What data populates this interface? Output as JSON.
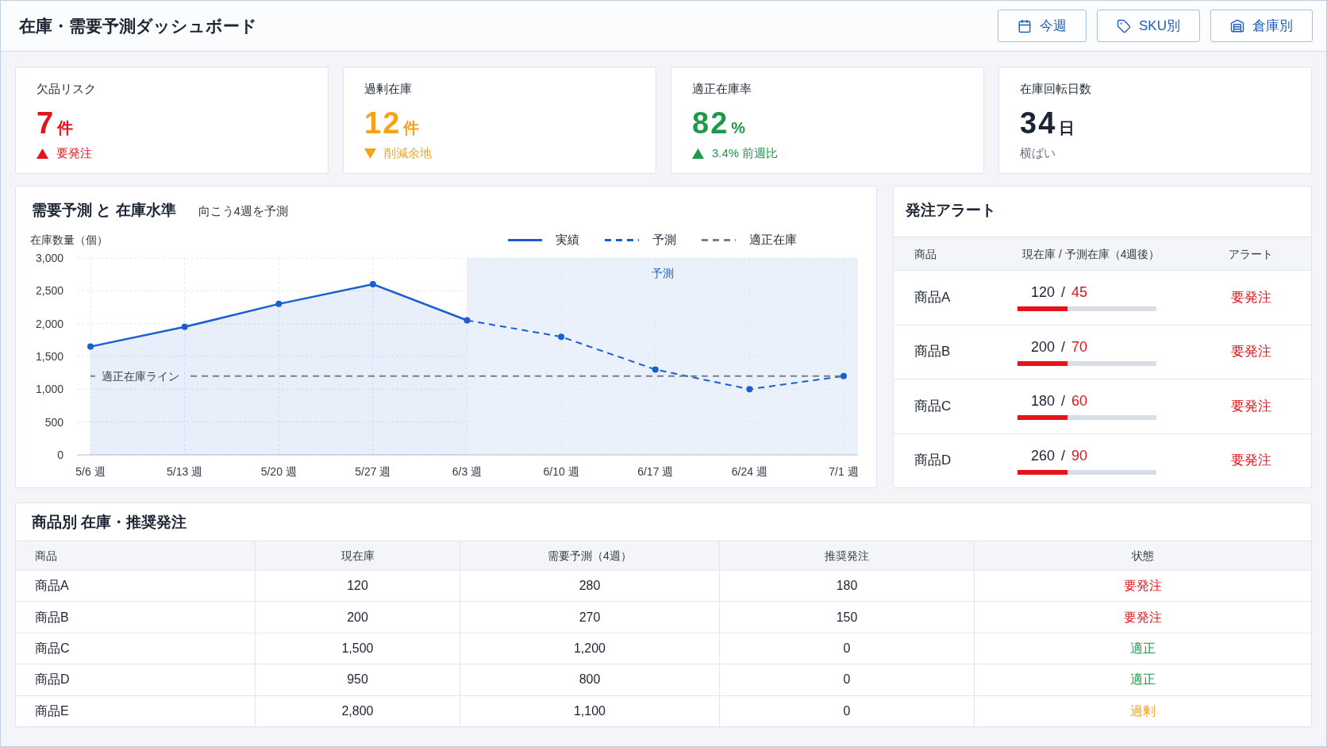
{
  "header": {
    "title": "在庫・需要予測ダッシュボード",
    "buttons": [
      {
        "label": "今週"
      },
      {
        "label": "SKU別"
      },
      {
        "label": "倉庫別"
      }
    ]
  },
  "kpis": [
    {
      "label": "欠品リスク",
      "value": "7",
      "unit": "件",
      "color": "#e3141b",
      "kind": "rise",
      "note": "要発注"
    },
    {
      "label": "過剰在庫",
      "value": "12",
      "unit": "件",
      "color": "#f5a31a",
      "kind": "fall",
      "note": "削減余地"
    },
    {
      "label": "適正在庫率",
      "value": "82",
      "unit": "%",
      "color": "#1e9a4b",
      "kind": "rise",
      "note": "3.4% 前週比"
    },
    {
      "label": "在庫回転日数",
      "value": "34",
      "unit": "日",
      "color": "#1b2433",
      "kind": "flat",
      "note": "横ばい"
    }
  ],
  "demand_chart": {
    "title": "需要予測 と 在庫水準",
    "subtitle": "向こう4週を予測",
    "chart_data": {
      "type": "line",
      "ylabel": "在庫数量（個）",
      "categories": [
        "5/6 週",
        "5/13 週",
        "5/20 週",
        "5/27 週",
        "6/3 週",
        "6/10 週",
        "6/17 週",
        "6/24 週",
        "7/1 週"
      ],
      "series": [
        {
          "name": "実績",
          "type": "area",
          "color": "#1a5fd0",
          "line_style": "solid",
          "marker": "circle",
          "values": [
            1650,
            1950,
            2300,
            2600,
            2050,
            null,
            null,
            null,
            null
          ]
        },
        {
          "name": "予測",
          "color": "#1a5fd0",
          "line_style": "dashed",
          "marker": "circle",
          "values": [
            null,
            null,
            null,
            null,
            2050,
            1800,
            1300,
            1000,
            1200
          ]
        },
        {
          "name": "適正在庫",
          "color": "#7a7f88",
          "line_style": "dashed",
          "values": [
            1200,
            1200,
            1200,
            1200,
            1200,
            1200,
            1200,
            1200,
            1200
          ]
        }
      ],
      "ylim": [
        0,
        3000
      ],
      "yticks": [
        {
          "value": 0,
          "label": "0"
        },
        {
          "value": 500,
          "label": "500"
        },
        {
          "value": 1000,
          "label": "1,000"
        },
        {
          "value": 1500,
          "label": "1,500"
        },
        {
          "value": 2000,
          "label": "2,000"
        },
        {
          "value": 2500,
          "label": "2,500"
        },
        {
          "value": 3000,
          "label": "3,000"
        }
      ],
      "grid": true,
      "legend": true,
      "bands": [
        {
          "axis": "x",
          "from": "6/3 週",
          "to": "7/1 週",
          "label": "予測",
          "color": "#eaf1fb"
        }
      ],
      "annotations": [
        {
          "text": "適正在庫ライン",
          "y": 1200
        }
      ]
    }
  },
  "alerts": {
    "title": "発注アラート",
    "columns": [
      "商品",
      "現在庫 / 予測在庫（4週後）",
      "アラート"
    ],
    "rows": [
      {
        "product": "商品A",
        "current": "120",
        "separator": "/",
        "forecast": "45",
        "level": 0.36,
        "alert": "要発注"
      },
      {
        "product": "商品B",
        "current": "200",
        "separator": "/",
        "forecast": "70",
        "level": 0.36,
        "alert": "要発注"
      },
      {
        "product": "商品C",
        "current": "180",
        "separator": "/",
        "forecast": "60",
        "level": 0.36,
        "alert": "要発注"
      },
      {
        "product": "商品D",
        "current": "260",
        "separator": "/",
        "forecast": "90",
        "level": 0.36,
        "alert": "要発注"
      }
    ]
  },
  "stock_table": {
    "title": "商品別 在庫・推奨発注",
    "columns": [
      "商品",
      "現在庫",
      "需要予測（4週）",
      "推奨発注",
      "状態"
    ],
    "rows": [
      {
        "product": "商品A",
        "stock": "120",
        "forecast": "280",
        "order": "180",
        "status": "要発注",
        "color": "#e3141b"
      },
      {
        "product": "商品B",
        "stock": "200",
        "forecast": "270",
        "order": "150",
        "status": "要発注",
        "color": "#e3141b"
      },
      {
        "product": "商品C",
        "stock": "1,500",
        "forecast": "1,200",
        "order": "0",
        "status": "適正",
        "color": "#1e9a4b"
      },
      {
        "product": "商品D",
        "stock": "950",
        "forecast": "800",
        "order": "0",
        "status": "適正",
        "color": "#1e9a4b"
      },
      {
        "product": "商品E",
        "stock": "2,800",
        "forecast": "1,100",
        "order": "0",
        "status": "過剰",
        "color": "#f5a31a"
      }
    ]
  }
}
